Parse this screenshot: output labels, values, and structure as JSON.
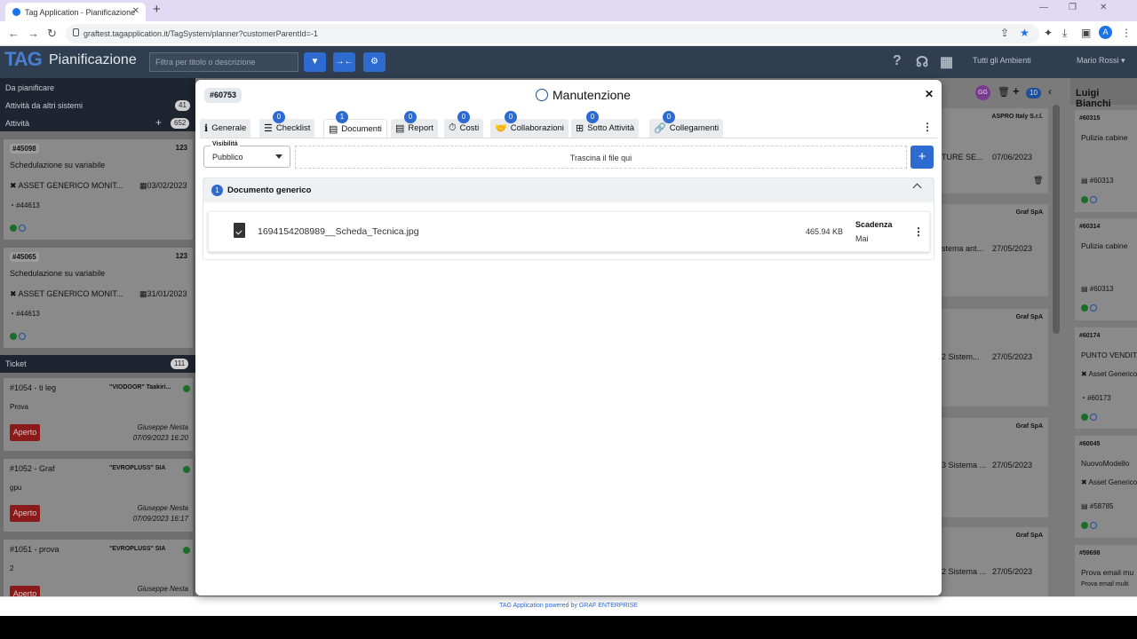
{
  "browser": {
    "tab_title": "Tag Application - Pianificazione",
    "url": "graftest.tagapplication.it/TagSystem/planner?customerParentId=-1",
    "profile_initial": "A"
  },
  "header": {
    "logo": "TAG",
    "title": "Pianificazione",
    "search_placeholder": "Filtra per titolo o descrizione",
    "ambienti_label": "Tutti gli Ambienti",
    "user_name": "Mario Rossi ▾"
  },
  "left_panel": {
    "da_pianificare": "Da pianificare",
    "altri_sistemi": "Attività da altri sistemi",
    "altri_sistemi_count": "41",
    "attivita": "Attività",
    "attivita_count": "652",
    "cards": [
      {
        "id": "#45098",
        "num": "123",
        "title": "Schedulazione su variabile",
        "asset": "ASSET GENERICO MONIT...",
        "date": "03/02/2023",
        "ref": "#44613"
      },
      {
        "id": "#45065",
        "num": "123",
        "title": "Schedulazione su variabile",
        "asset": "ASSET GENERICO MONIT...",
        "date": "31/01/2023",
        "ref": "#44613"
      }
    ],
    "ticket_label": "Ticket",
    "ticket_count": "111",
    "tickets": [
      {
        "id": "#1054 - ti leg",
        "customer": "\"VIODOOR\" Taakiri...",
        "desc": "Prova",
        "status": "Aperto",
        "user": "Giuseppe Nesta",
        "date": "07/09/2023 16:20"
      },
      {
        "id": "#1052 - Graf",
        "customer": "\"EVROPLUSS\" SIA",
        "desc": "gpu",
        "status": "Aperto",
        "user": "Giuseppe Nesta",
        "date": "07/09/2023 16:17"
      },
      {
        "id": "#1051 - prova",
        "customer": "\"EVROPLUSS\" SIA",
        "desc": "2",
        "status": "Aperto",
        "user": "Giuseppe Nesta",
        "date": ""
      }
    ]
  },
  "right_bg": {
    "gg_avatar": "GG",
    "count_badge": "10",
    "col1": [
      {
        "company": "ASPRO Italy S.r.l.",
        "text": "TURE SE...",
        "date": "07/06/2023"
      },
      {
        "company": "Graf SpA",
        "text": "stema ant...",
        "date": "27/05/2023"
      },
      {
        "company": "Graf SpA",
        "text": "2 Sistem...",
        "date": "27/05/2023"
      },
      {
        "company": "Graf SpA",
        "text": "3 Sistema ...",
        "date": "27/05/2023"
      },
      {
        "company": "Graf SpA",
        "text": "2 Sistema ...",
        "date": "27/05/2023"
      }
    ],
    "luigi": "Luigi Bianchi",
    "col2": [
      {
        "id": "#60315",
        "title": "Pulizia cabine",
        "ref": "#60313"
      },
      {
        "id": "#60314",
        "title": "Pulizia cabine",
        "ref": "#60313"
      },
      {
        "id": "#60174",
        "title": "PUNTO VENDITA",
        "asset": "Asset Generico",
        "ref": "#60173"
      },
      {
        "id": "#60045",
        "title": "NuovoModello",
        "asset": "Asset Generico",
        "ref": "#58785"
      },
      {
        "id": "#59698",
        "title": "Prova email mu",
        "sub": "Prova email multi"
      }
    ]
  },
  "modal": {
    "id": "#60753",
    "title": "Manutenzione",
    "tabs": [
      {
        "label": "Generale",
        "badge": ""
      },
      {
        "label": "Checklist",
        "badge": "0"
      },
      {
        "label": "Documenti",
        "badge": "1"
      },
      {
        "label": "Report",
        "badge": "0"
      },
      {
        "label": "Costi",
        "badge": "0"
      },
      {
        "label": "Collaborazioni",
        "badge": "0"
      },
      {
        "label": "Sotto Attività",
        "badge": "0"
      },
      {
        "label": "Collegamenti",
        "badge": "0"
      }
    ],
    "visibility_label": "Visibilità",
    "visibility_value": "Pubblico",
    "dropzone_text": "Trascina il file qui",
    "add_symbol": "+",
    "group": {
      "count": "1",
      "title": "Documento generico"
    },
    "file": {
      "name": "1694154208989__Scheda_Tecnica.jpg",
      "size": "465.94 KB",
      "deadline_label": "Scadenza",
      "deadline_value": "Mai"
    }
  },
  "footer": {
    "text": "TAG Application powered by GRAF ENTERPRISE"
  }
}
